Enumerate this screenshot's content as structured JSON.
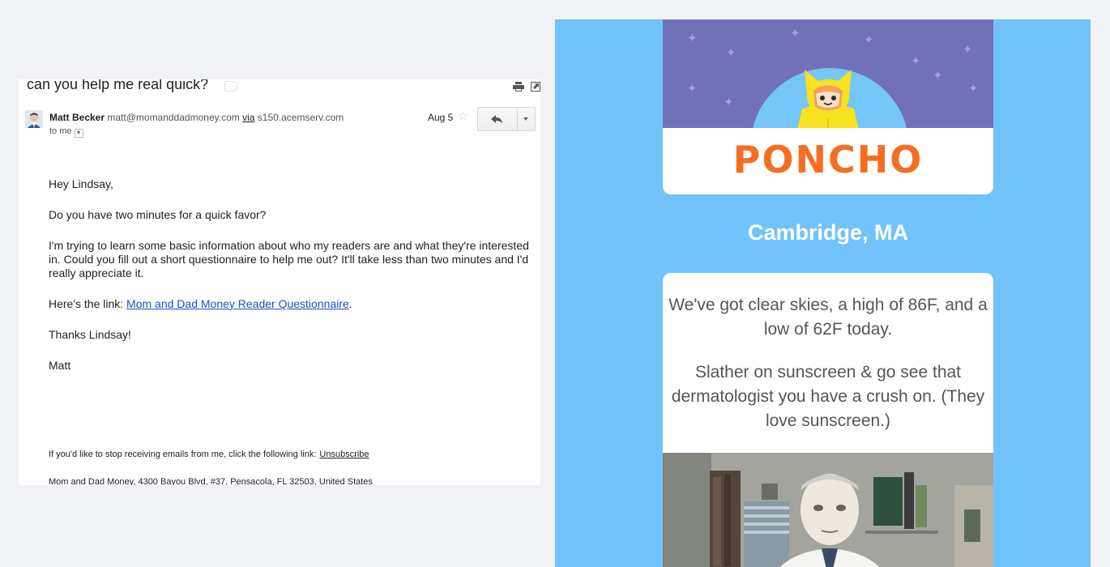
{
  "email": {
    "subject": "can you help me real quick?",
    "sender_name": "Matt Becker",
    "sender_email": "matt@momanddadmoney.com",
    "via_label": "via",
    "via_host": "s150.acemserv.com",
    "to_line": "to me",
    "date": "Aug 5",
    "greeting": "Hey Lindsay,",
    "p1": "Do you have two minutes for a quick favor?",
    "p2": "I'm trying to learn some basic information about who my readers are and what they're interested in. Could you fill out a short questionnaire to help me out? It'll take less than two minutes and I'd really appreciate it.",
    "p3_prefix": "Here's the link: ",
    "p3_link": "Mom and Dad Money Reader Questionnaire",
    "p3_suffix": ".",
    "thanks": "Thanks Lindsay!",
    "signature": "Matt",
    "footer_text": "If you'd like to stop receiving emails from me, click the following link:",
    "footer_link": "Unsubscribe",
    "footer_address": "Mom and Dad Money, 4300 Bayou Blvd, #37, Pensacola, FL 32503, United States"
  },
  "poncho": {
    "logo_text": "PONCHO",
    "city": "Cambridge, MA",
    "message1": "We've got clear skies, a high of 86F, and a low of 62F today.",
    "message2": "Slather on sunscreen & go see that dermatologist you have a crush on. (They love sunscreen.)",
    "colors": {
      "panel_bg": "#73c3fb",
      "sky": "#7170b8",
      "logo": "#f46f23",
      "cat": "#f8e11f"
    }
  }
}
